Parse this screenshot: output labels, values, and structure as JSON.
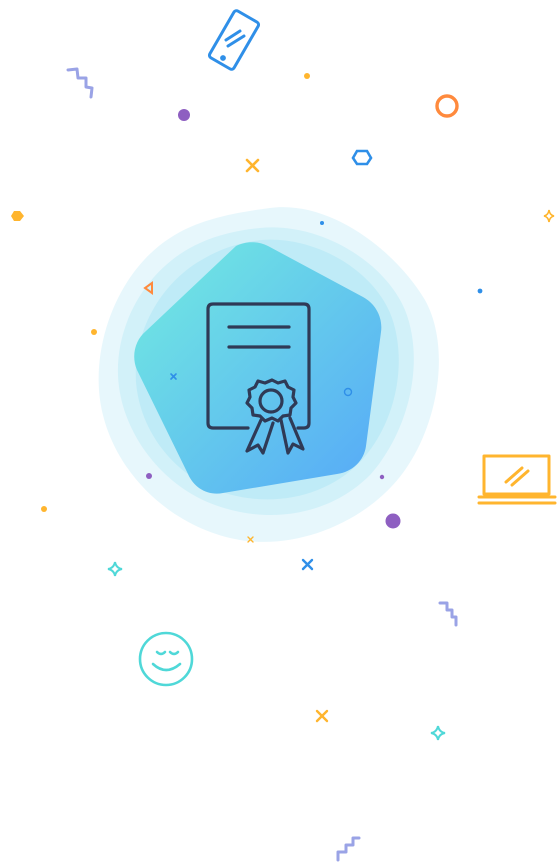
{
  "illustration": {
    "central_icon": "certificate-with-ribbon-icon",
    "background_shape": "rounded-pentagon-badge",
    "decorations": [
      "smartphone-icon",
      "laptop-icon",
      "smiley-face-icon",
      "zigzag-icon",
      "ring-icon",
      "hexagon-icon",
      "triangle-icon",
      "cross-icon",
      "four-point-star-icon",
      "dot-icon"
    ]
  },
  "colors": {
    "badge_gradient_start": "#6fe6e0",
    "badge_gradient_end": "#5aaef8",
    "badge_halo": "#d9f3fb",
    "icon_stroke": "#2f3a56",
    "blue": "#2f8fe8",
    "orange": "#ff8a3d",
    "yellow": "#ffb52e",
    "purple": "#8e5fc1",
    "lavender": "#9aa3e6",
    "cyan": "#4fd8d8"
  }
}
